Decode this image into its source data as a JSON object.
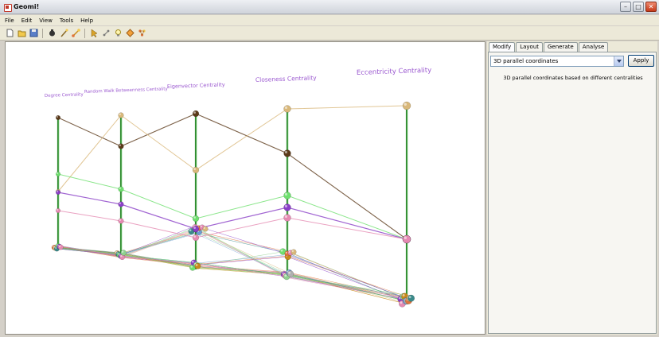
{
  "window": {
    "title": "Geomi!",
    "minimize_glyph": "–",
    "maximize_glyph": "□",
    "close_glyph": "✕"
  },
  "menu": [
    "File",
    "Edit",
    "View",
    "Tools",
    "Help"
  ],
  "toolbar": {
    "groups": [
      [
        "new-file-icon",
        "open-folder-icon",
        "save-icon"
      ],
      [
        "hand-icon",
        "wand-icon",
        "node-tool-icon"
      ],
      [
        "pointer-icon",
        "search-graph-icon",
        "light-bulb-icon",
        "diamond-icon",
        "layout-icon"
      ]
    ]
  },
  "viewport": {
    "axis_labels": [
      "Degree Centrality",
      "Random Walk Betweenness Centrality",
      "Eigenvector Centrality",
      "Closeness Centrality",
      "Eccentricity Centrality"
    ]
  },
  "panel": {
    "tabs": [
      "Modify",
      "Layout",
      "Generate",
      "Analyse"
    ],
    "active_tab": "Modify",
    "select_value": "3D parallel coordinates",
    "apply_label": "Apply",
    "description": "3D parallel coordinates based on different centralities"
  },
  "colors": {
    "axis": "#2e8b2e",
    "brown": "#5b3a1a",
    "tan": "#d9b87a",
    "green": "#6ee06e",
    "purple": "#8a3fc7",
    "pink": "#e58ab2",
    "orange": "#e0733a",
    "teal": "#3a8a8a",
    "label": "#9b59d0"
  }
}
